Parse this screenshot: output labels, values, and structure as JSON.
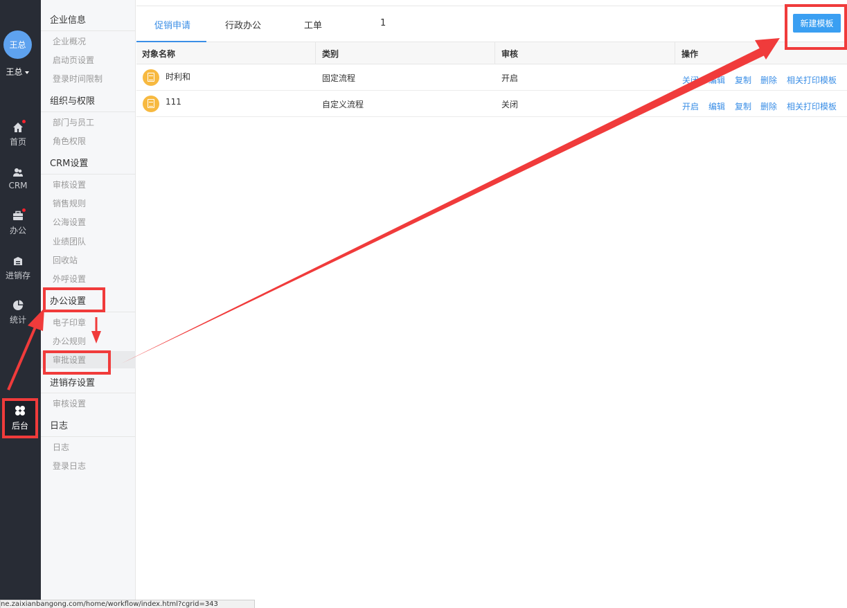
{
  "nav": {
    "avatar_text": "王总",
    "user_name": "王总",
    "items": [
      {
        "label": "首页",
        "icon": "home-icon"
      },
      {
        "label": "CRM",
        "icon": "users-icon"
      },
      {
        "label": "办公",
        "icon": "briefcase-icon"
      },
      {
        "label": "进销存",
        "icon": "inventory-icon"
      },
      {
        "label": "统计",
        "icon": "pie-chart-icon"
      }
    ],
    "backend_label": "后台"
  },
  "submenu": {
    "groups": [
      {
        "title": "企业信息",
        "items": [
          "企业概况",
          "启动页设置",
          "登录时间限制"
        ]
      },
      {
        "title": "组织与权限",
        "items": [
          "部门与员工",
          "角色权限"
        ]
      },
      {
        "title": "CRM设置",
        "items": [
          "审核设置",
          "销售规则",
          "公海设置",
          "业绩团队",
          "回收站",
          "外呼设置"
        ]
      },
      {
        "title": "办公设置",
        "items": [
          "电子印章",
          "办公规则",
          "审批设置"
        ]
      },
      {
        "title": "进销存设置",
        "items": [
          "审核设置"
        ]
      },
      {
        "title": "日志",
        "items": [
          "日志",
          "登录日志"
        ]
      }
    ]
  },
  "tabs": [
    {
      "label": "促销申请"
    },
    {
      "label": "行政办公"
    },
    {
      "label": "工单"
    },
    {
      "label": "1"
    }
  ],
  "new_template_label": "新建模板",
  "table": {
    "columns": [
      "对象名称",
      "类别",
      "审核",
      "操作"
    ],
    "rows": [
      {
        "name": "时利和",
        "category": "固定流程",
        "review": "开启",
        "ops": [
          "关闭",
          "编辑",
          "复制",
          "删除",
          "相关打印模板"
        ]
      },
      {
        "name": "111",
        "category": "自定义流程",
        "review": "关闭",
        "ops": [
          "开启",
          "编辑",
          "复制",
          "删除",
          "相关打印模板"
        ]
      }
    ]
  },
  "status_url": "ne.zaixianbangong.com/home/workflow/index.html?cgrid=343",
  "colors": {
    "accent": "#3a8ee6",
    "annotation": "#f03b3b",
    "nav_bg": "#282c35"
  }
}
